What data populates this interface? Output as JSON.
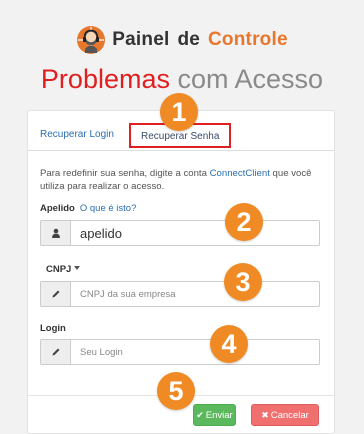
{
  "header": {
    "title_part1": "Painel",
    "title_part2": "de",
    "title_part3": "Controle",
    "logo_icon": "support-headset-icon"
  },
  "page_title": {
    "part1": "Problemas",
    "part2": "com Acesso"
  },
  "tabs": [
    {
      "label": "Recuperar Login",
      "active": false
    },
    {
      "label": "Recuperar Senha",
      "active": true
    }
  ],
  "description": {
    "before": "Para redefinir sua senha, digite a conta ",
    "brand1": "Connect",
    "brand2": "Client",
    "after": " que você utiliza para realizar o acesso."
  },
  "fields": {
    "apelido": {
      "label": "Apelido",
      "help_link": "O que é isto?",
      "value": "apelido",
      "icon": "user-icon"
    },
    "cnpj": {
      "label": "CNPJ",
      "placeholder": "CNPJ da sua empresa",
      "icon": "pencil-icon"
    },
    "login": {
      "label": "Login",
      "placeholder": "Seu Login",
      "icon": "pencil-icon"
    }
  },
  "buttons": {
    "enviar": "Enviar",
    "cancelar": "Cancelar"
  },
  "markers": [
    "1",
    "2",
    "3",
    "4",
    "5"
  ],
  "colors": {
    "accent_orange": "#f08a24",
    "title_red": "#e02020",
    "link_blue": "#2a6fb0",
    "success_green": "#5cb85c",
    "danger_red": "#f07070"
  }
}
